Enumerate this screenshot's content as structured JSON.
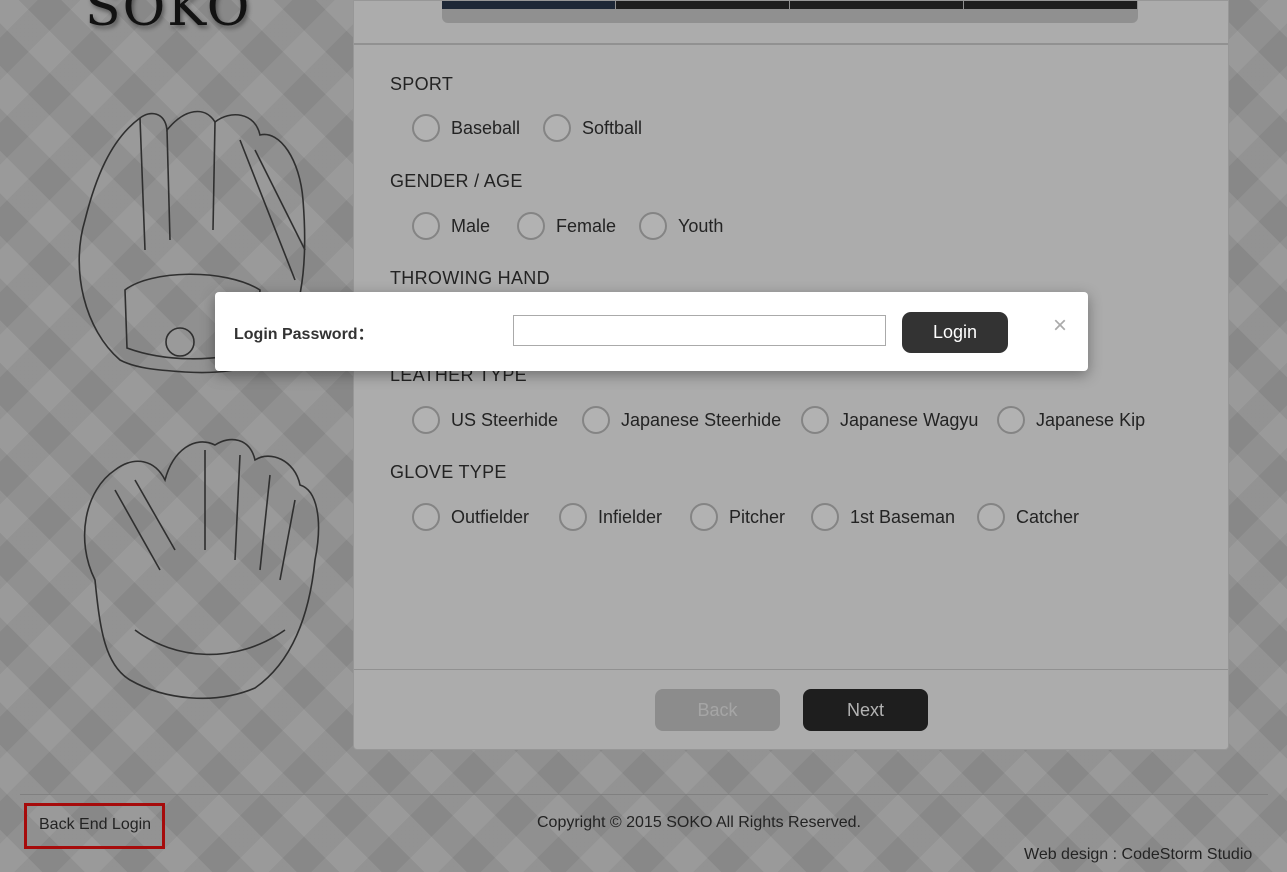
{
  "brand": {
    "logo": "SOKO"
  },
  "tabs": [
    "",
    "",
    "",
    ""
  ],
  "sections": [
    {
      "title": "SPORT",
      "options": [
        "Baseball",
        "Softball"
      ]
    },
    {
      "title": "GENDER / AGE",
      "options": [
        "Male",
        "Female",
        "Youth"
      ]
    },
    {
      "title": "THROWING HAND",
      "options": []
    },
    {
      "title": "LEATHER TYPE",
      "options": [
        "US Steerhide",
        "Japanese Steerhide",
        "Japanese Wagyu",
        "Japanese Kip"
      ]
    },
    {
      "title": "GLOVE TYPE",
      "options": [
        "Outfielder",
        "Infielder",
        "Pitcher",
        "1st Baseman",
        "Catcher"
      ]
    }
  ],
  "nav": {
    "back": "Back",
    "next": "Next"
  },
  "footer": {
    "backend_login": "Back End Login",
    "copyright": "Copyright © 2015 SOKO All Rights Reserved.",
    "credit": "Web design : CodeStorm Studio"
  },
  "modal": {
    "label": "Login Password：",
    "password_value": "",
    "login_button": "Login",
    "close": "×"
  },
  "colors": {
    "accent_dark": "#2b2b2b",
    "highlight_box": "#ee1111"
  }
}
